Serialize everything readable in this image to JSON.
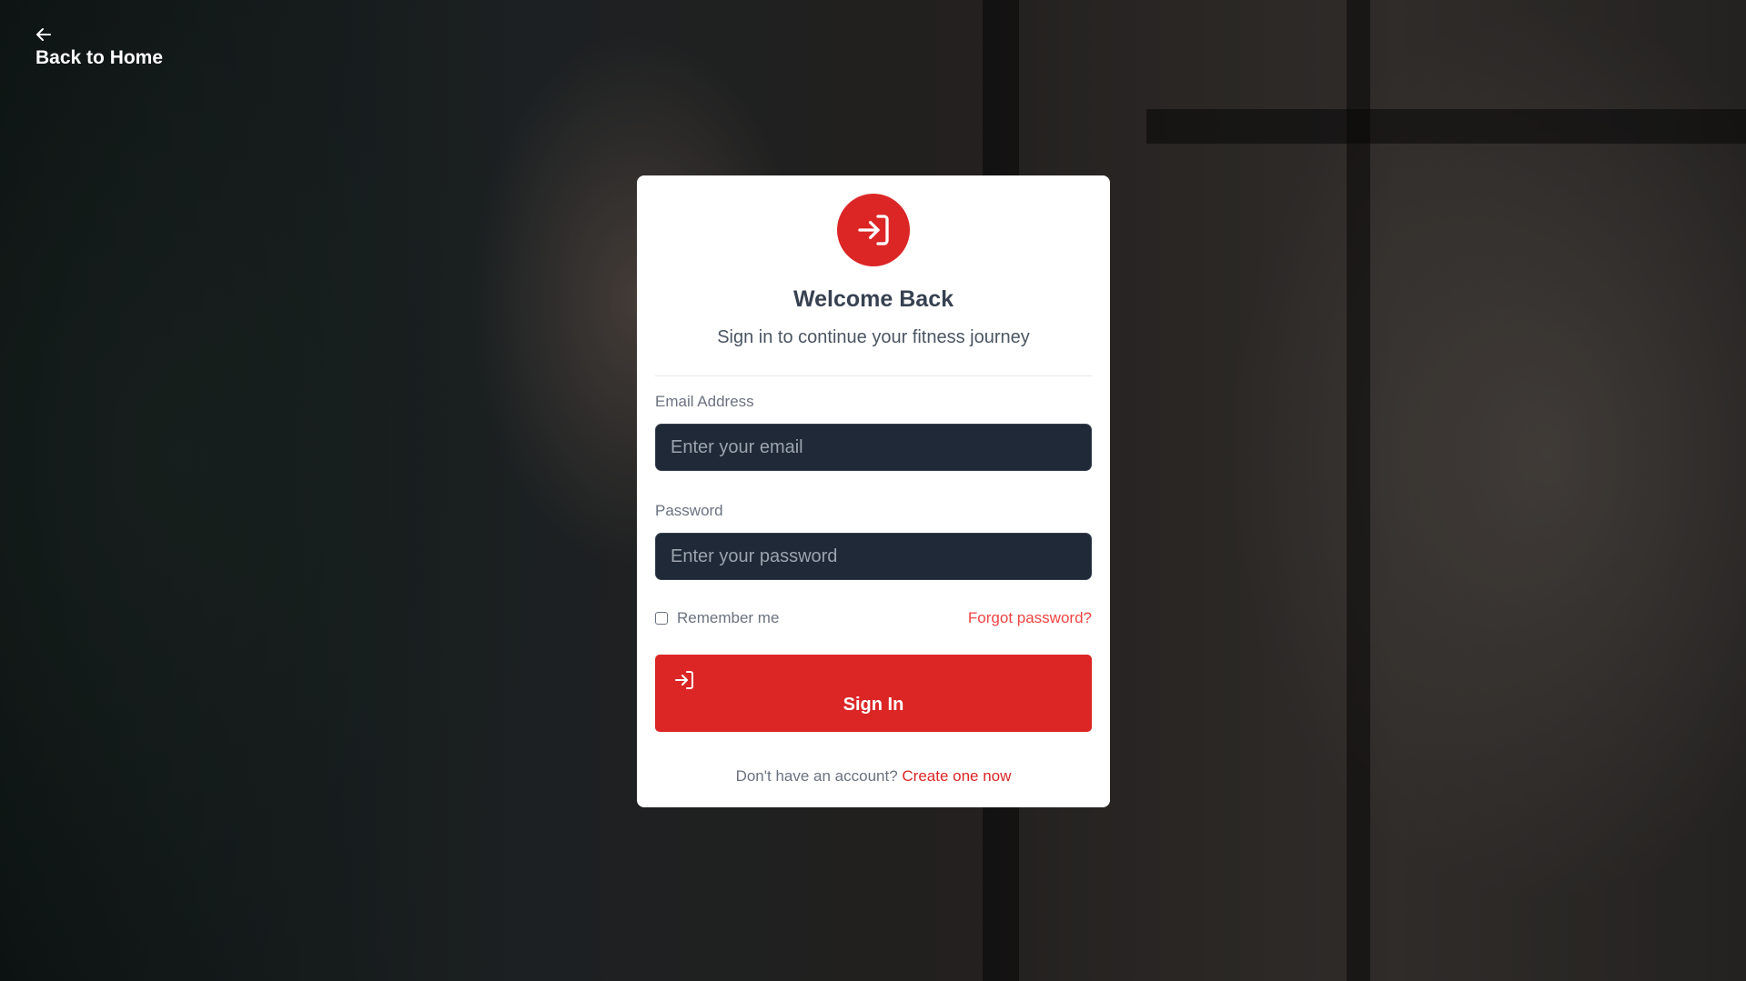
{
  "nav": {
    "back_label": "Back to Home",
    "back_icon": "arrow-left-icon"
  },
  "card": {
    "logo_icon": "sign-in-icon",
    "title": "Welcome Back",
    "subtitle": "Sign in to continue your fitness journey"
  },
  "form": {
    "email_label": "Email Address",
    "email_placeholder": "Enter your email",
    "email_value": "",
    "password_label": "Password",
    "password_placeholder": "Enter your password",
    "password_value": "",
    "remember_label": "Remember me",
    "remember_checked": false,
    "forgot_label": "Forgot password?",
    "submit_label": "Sign In",
    "submit_icon": "sign-in-icon"
  },
  "footer": {
    "prompt": "Don't have an account?",
    "create_label": "Create one now"
  },
  "colors": {
    "accent": "#dc2626",
    "input_bg": "#1f2937",
    "heading": "#374151"
  }
}
